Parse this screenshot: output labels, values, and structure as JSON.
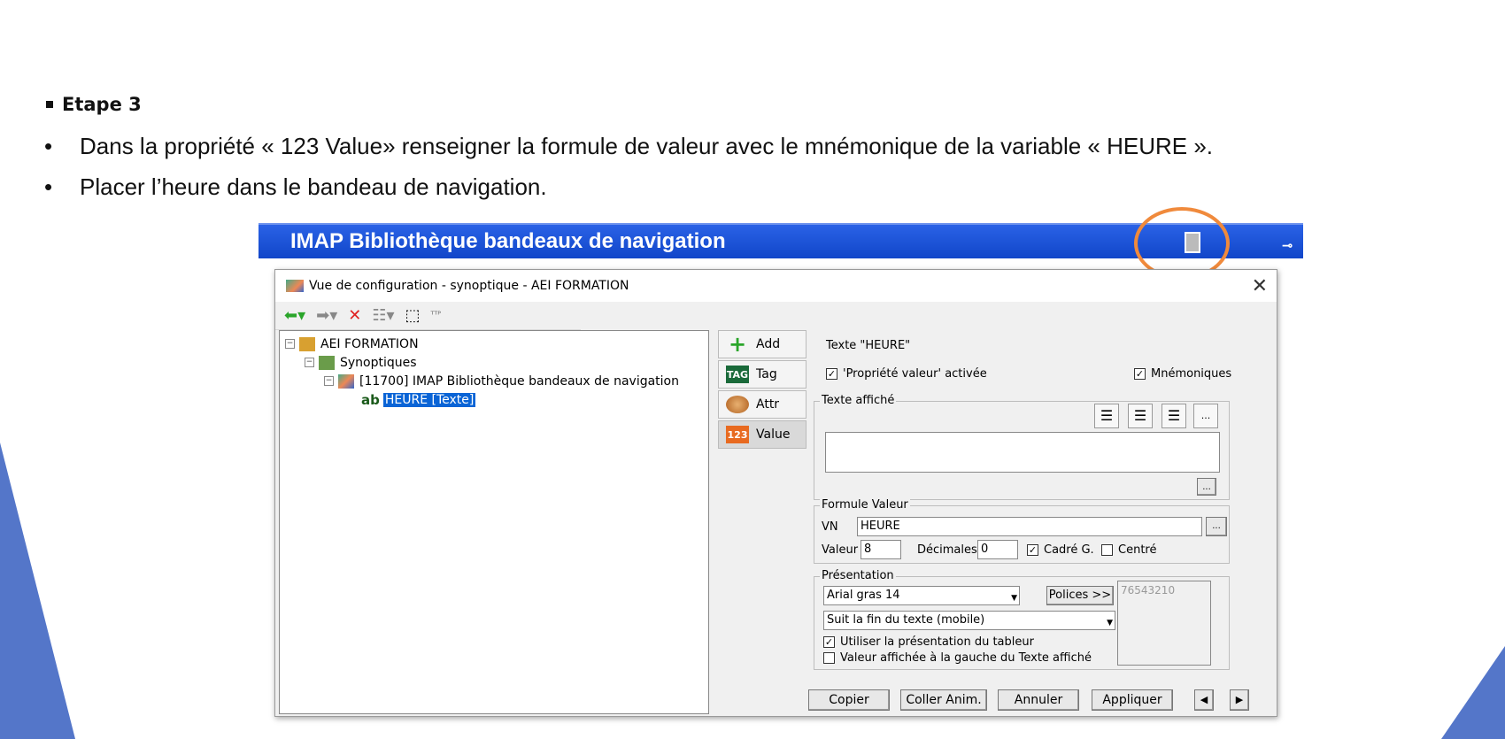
{
  "slide": {
    "step_title": "Etape 3",
    "bullets": [
      "Dans la propriété « 123 Value» renseigner la formule de valeur avec le mnémonique de la variable « HEURE ».",
      "Placer l’heure dans le bandeau de navigation."
    ],
    "bullet_char": "•"
  },
  "banner": {
    "title": "IMAP Bibliothèque bandeaux de navigation"
  },
  "dialog": {
    "title": "Vue de configuration - synoptique - AEI FORMATION",
    "close": "✕",
    "tree": [
      "AEI FORMATION",
      "Synoptiques",
      "[11700]  IMAP Bibliothèque bandeaux de navigation",
      "HEURE [Texte]"
    ],
    "tree_text_prefix": "ab",
    "tabs": [
      "Add",
      "Tag",
      "Attr",
      "Value"
    ],
    "tab_icon_labels": [
      "+",
      "TAG",
      "",
      "123"
    ],
    "header": "Texte  \"HEURE\"",
    "prop_value_enabled": "'Propriété valeur' activée",
    "mnemoniques": "Mnémoniques",
    "texte_affiche_title": "Texte affiché",
    "ellipsis": "...",
    "formule_title": "Formule Valeur",
    "vn_label": "VN",
    "vn_value": "HEURE",
    "valeur_label": "Valeur",
    "valeur_value": "8",
    "decimales_label": "Décimales",
    "decimales_value": "0",
    "cadre_label": "Cadré G.",
    "centre_label": "Centré",
    "presentation_title": "Présentation",
    "font_select": "Arial gras  14",
    "polices_btn": "Polices >>",
    "preview_text": "76543210",
    "position_select": "Suit la fin du texte (mobile)",
    "use_table_presentation": "Utiliser la présentation du tableur",
    "value_left": "Valeur affichée à la gauche du Texte affiché",
    "footer": {
      "copier": "Copier",
      "coller": "Coller Anim.",
      "annuler": "Annuler",
      "appliquer": "Appliquer",
      "prev": "◀",
      "next": "▶"
    }
  }
}
